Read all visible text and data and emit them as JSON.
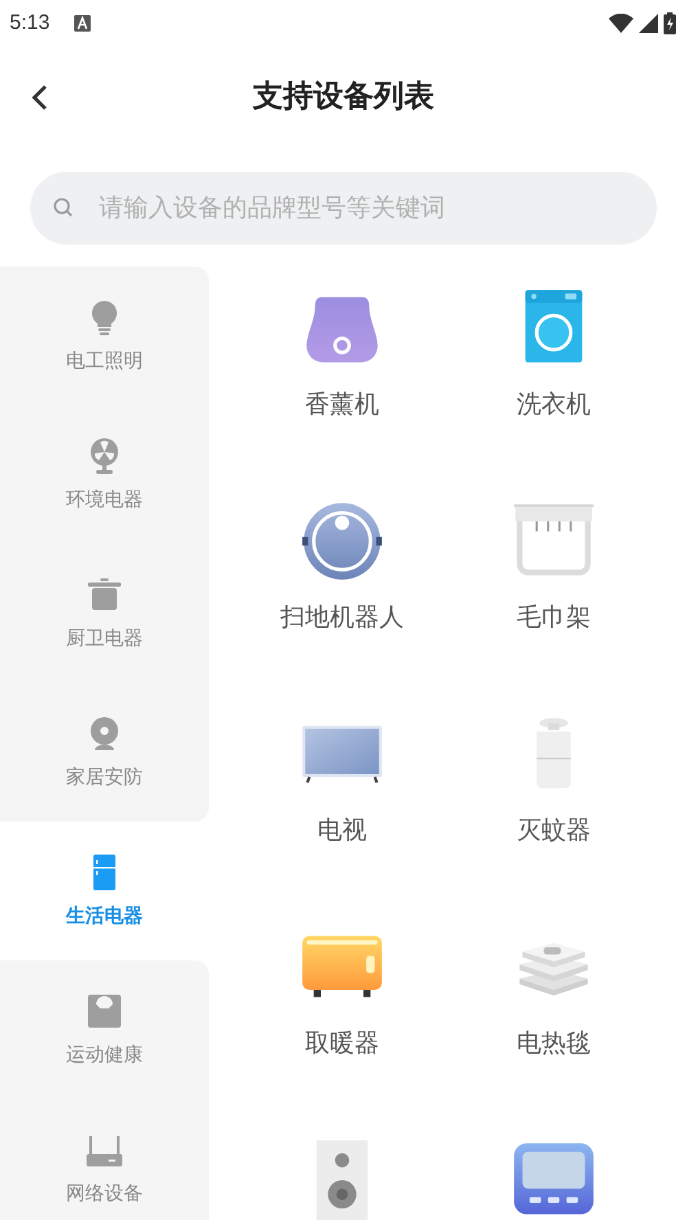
{
  "status_bar": {
    "time": "5:13"
  },
  "header": {
    "title": "支持设备列表"
  },
  "search": {
    "placeholder": "请输入设备的品牌型号等关键词"
  },
  "sidebar": {
    "items": [
      {
        "kind": "bulb",
        "label": "电工照明",
        "selected": false
      },
      {
        "kind": "fan",
        "label": "环境电器",
        "selected": false
      },
      {
        "kind": "pot",
        "label": "厨卫电器",
        "selected": false
      },
      {
        "kind": "camera",
        "label": "家居安防",
        "selected": false
      },
      {
        "kind": "fridge",
        "label": "生活电器",
        "selected": true
      },
      {
        "kind": "scale",
        "label": "运动健康",
        "selected": false
      },
      {
        "kind": "router",
        "label": "网络设备",
        "selected": false
      }
    ]
  },
  "devices": [
    {
      "kind": "aroma",
      "label": "香薰机"
    },
    {
      "kind": "washer",
      "label": "洗衣机"
    },
    {
      "kind": "robot",
      "label": "扫地机器人"
    },
    {
      "kind": "towel",
      "label": "毛巾架"
    },
    {
      "kind": "tv",
      "label": "电视"
    },
    {
      "kind": "mosquito",
      "label": "灭蚊器"
    },
    {
      "kind": "heater",
      "label": "取暖器"
    },
    {
      "kind": "blanket",
      "label": "电热毯"
    },
    {
      "kind": "speaker"
    },
    {
      "kind": "panel"
    }
  ]
}
